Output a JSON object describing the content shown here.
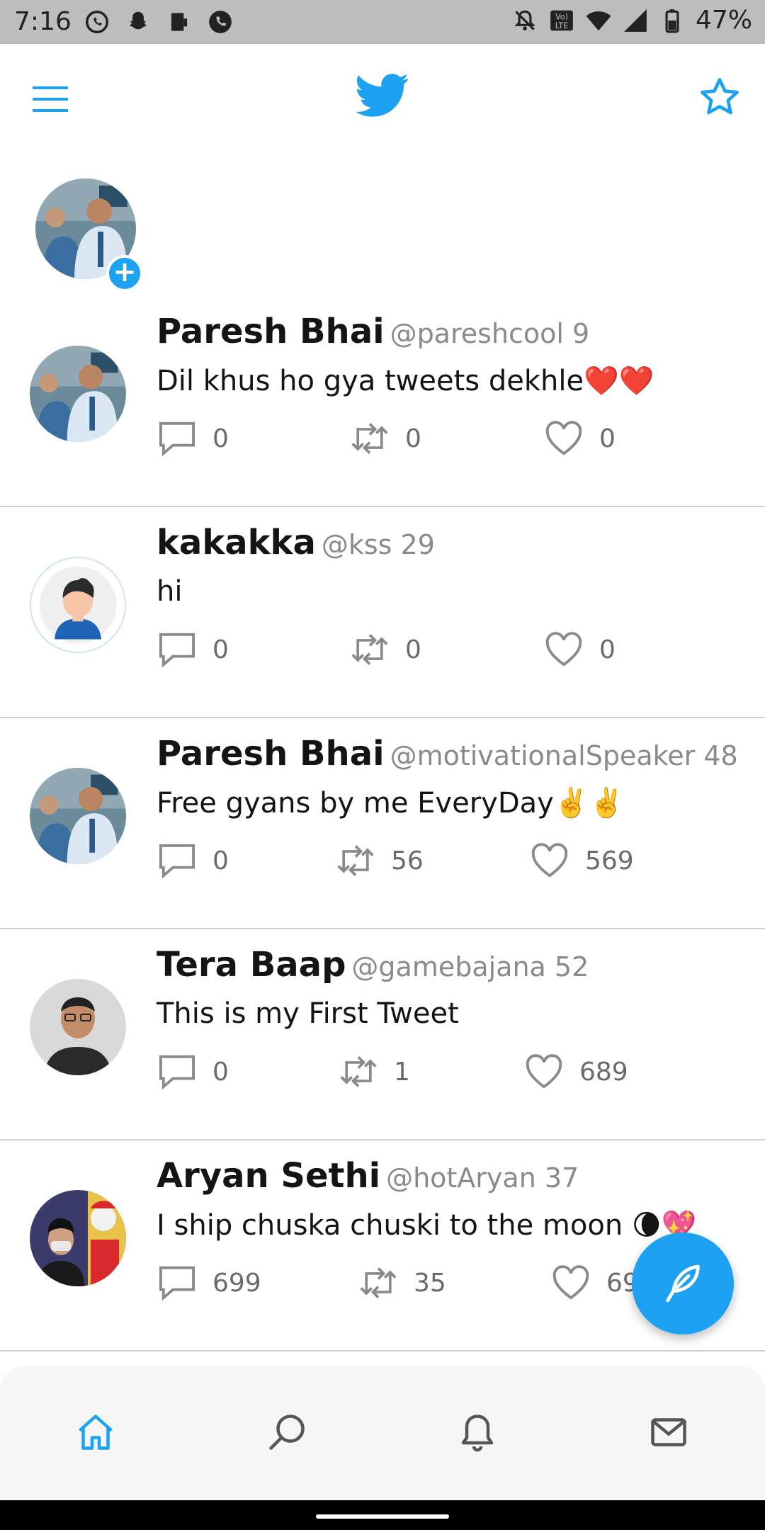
{
  "status_bar": {
    "time": "7:16",
    "battery": "47%"
  },
  "app": {
    "accent": "#1da1f2"
  },
  "tweets": [
    {
      "name": "Paresh Bhai",
      "handle": "@pareshcool 9",
      "text": "Dil khus ho gya tweets dekhle❤️❤️",
      "replies": "0",
      "retweets": "0",
      "likes": "0"
    },
    {
      "name": "kakakka",
      "handle": "@kss 29",
      "text": "hi",
      "replies": "0",
      "retweets": "0",
      "likes": "0"
    },
    {
      "name": "Paresh Bhai",
      "handle": "@motivationalSpeaker 48",
      "text": "Free gyans by me EveryDay✌️✌️",
      "replies": "0",
      "retweets": "56",
      "likes": "569"
    },
    {
      "name": "Tera Baap",
      "handle": "@gamebajana 52",
      "text": "This is my First Tweet",
      "replies": "0",
      "retweets": "1",
      "likes": "689"
    },
    {
      "name": "Aryan Sethi",
      "handle": "@hotAryan 37",
      "text": "I ship chuska chuski to the moon 🌘💖",
      "replies": "699",
      "retweets": "35",
      "likes": "69"
    }
  ],
  "icons": {
    "menu": "menu-icon",
    "logo": "twitter-bird-icon",
    "star": "star-icon",
    "reply": "comment-icon",
    "retweet": "retweet-icon",
    "like": "heart-icon",
    "compose": "feather-icon",
    "home": "home-icon",
    "search": "search-icon",
    "notifications": "bell-icon",
    "messages": "mail-icon"
  }
}
